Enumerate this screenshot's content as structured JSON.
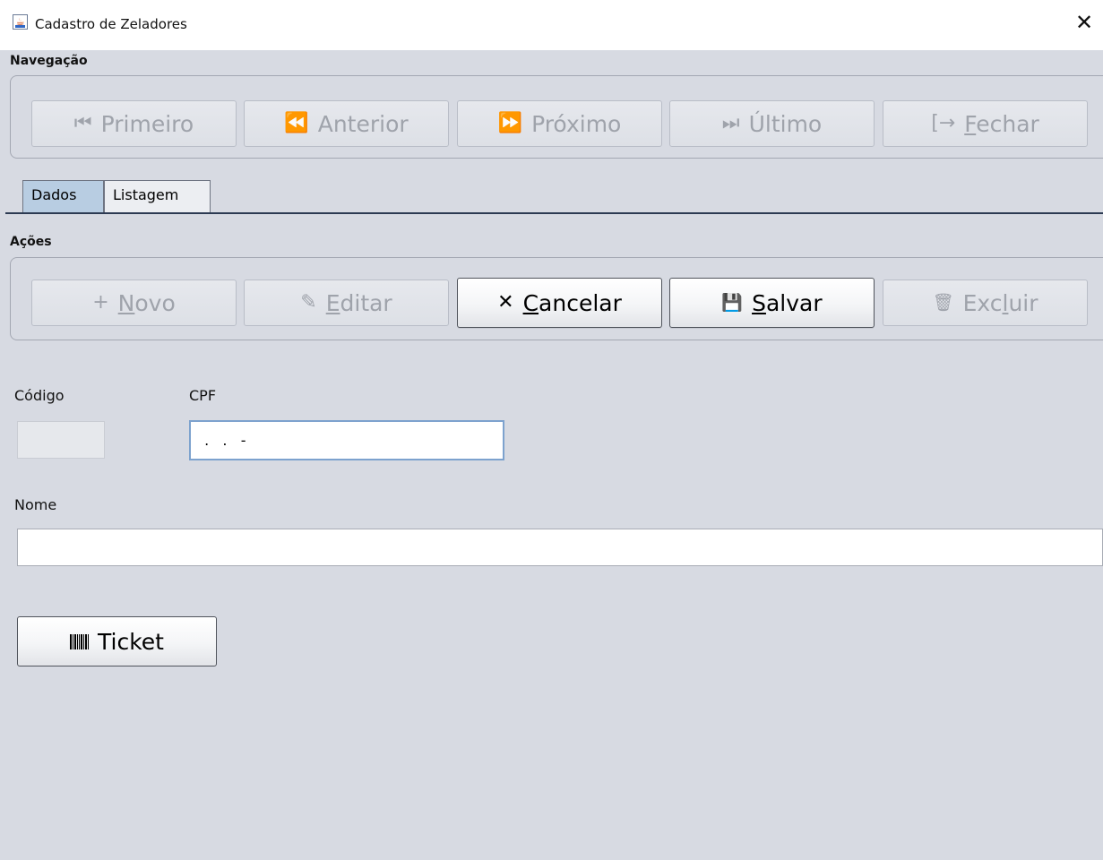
{
  "window": {
    "title": "Cadastro de Zeladores",
    "close_glyph": "✕"
  },
  "navigation": {
    "group_title": "Navegação",
    "buttons": [
      {
        "label": "Primeiro",
        "icon": "first-icon",
        "glyph": "⏮",
        "enabled": false
      },
      {
        "label": "Anterior",
        "icon": "rewind-icon",
        "glyph": "⏪",
        "enabled": false
      },
      {
        "label": "Próximo",
        "icon": "fast-forward-icon",
        "glyph": "⏩",
        "enabled": false
      },
      {
        "label": "Último",
        "icon": "last-icon",
        "glyph": "⏭",
        "enabled": false
      },
      {
        "label_mnemonic": "F",
        "label_rest": "echar",
        "icon": "exit-icon",
        "glyph": "[→",
        "enabled": false
      }
    ]
  },
  "tabs": [
    {
      "label": "Dados",
      "active": true
    },
    {
      "label": "Listagem",
      "active": false
    }
  ],
  "actions": {
    "group_title": "Ações",
    "buttons": [
      {
        "label_mnemonic": "N",
        "label_rest": "ovo",
        "icon": "plus-icon",
        "glyph": "+",
        "enabled": false
      },
      {
        "label_mnemonic": "E",
        "label_rest": "ditar",
        "icon": "pencil-icon",
        "glyph": "✎",
        "enabled": false
      },
      {
        "label_mnemonic": "C",
        "label_rest": "ancelar",
        "icon": "close-icon",
        "glyph": "✕",
        "enabled": true
      },
      {
        "label_mnemonic": "S",
        "label_rest": "alvar",
        "icon": "save-icon",
        "glyph": "💾",
        "enabled": true
      },
      {
        "label_pre": "Exc",
        "label_mnemonic": "l",
        "label_rest": "uir",
        "icon": "trash-icon",
        "glyph": "🗑",
        "enabled": false
      }
    ]
  },
  "form": {
    "codigo_label": "Código",
    "codigo_value": "",
    "cpf_label": "CPF",
    "cpf_value": " .   .   -",
    "nome_label": "Nome",
    "nome_value": ""
  },
  "ticket_button": {
    "label": "Ticket",
    "icon": "barcode-icon"
  },
  "colors": {
    "background": "#d7dae2",
    "active_tab": "#b8cde2",
    "focus_border": "#7da2ce",
    "disabled_text": "#9fa3ab"
  }
}
